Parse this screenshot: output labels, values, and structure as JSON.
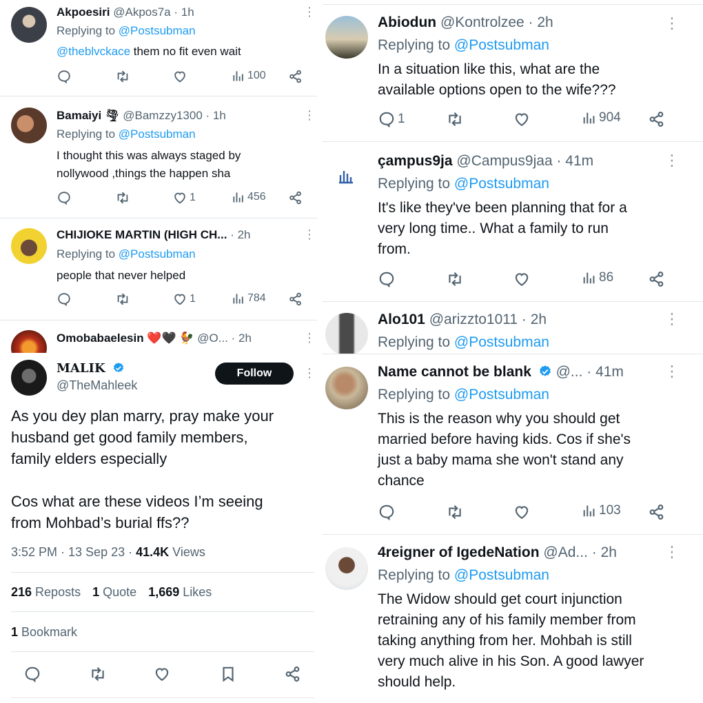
{
  "left_replies": [
    {
      "name": "Akpoesiri",
      "handle": "@Akpos7a",
      "time": "· 1h",
      "replying_label": "Replying to",
      "replying_handle": "@Postsubman",
      "mention": "@theblvckace",
      "text": " them no fit even wait",
      "reply_count": "",
      "like_count": "",
      "views": "100"
    },
    {
      "name": "Bamaiyi 🌪",
      "handle": "@Bamzzy1300",
      "time": "· 1h",
      "replying_label": "Replying to",
      "replying_handle": "@Postsubman",
      "text_lines": [
        "I thought this was always staged by",
        "nollywood ,things the  happen sha"
      ],
      "reply_count": "",
      "like_count": "1",
      "views": "456"
    },
    {
      "name": "CHIJIOKE MARTIN (HIGH CH...",
      "handle": "",
      "time": "· 2h",
      "replying_label": "Replying to",
      "replying_handle": "@Postsubman",
      "text_lines": [
        "people that never helped"
      ],
      "reply_count": "",
      "like_count": "1",
      "views": "784"
    },
    {
      "name": "Omobabaelesin ❤️🖤 🐓",
      "handle": "@O...",
      "time": "· 2h"
    }
  ],
  "main_tweet": {
    "name": "MALIK",
    "handle": "@TheMahleek",
    "follow_label": "Follow",
    "text_lines": [
      "As you dey plan marry, pray make your",
      "husband get good family members,",
      "family elders especially",
      "",
      "Cos what are these videos I’m seeing",
      "from Mohbad’s burial ffs??"
    ],
    "timestamp": "3:52 PM · 13 Sep 23 · ",
    "views": "41.4K",
    "views_label": " Views",
    "reposts": "216",
    "reposts_label": " Reposts",
    "quotes": "1",
    "quotes_label": " Quote",
    "likes": "1,669",
    "likes_label": " Likes",
    "bookmarks": "1",
    "bookmarks_label": " Bookmark"
  },
  "right_replies": [
    {
      "name": "Abiodun",
      "handle": "@Kontrolzee",
      "time": "· 2h",
      "replying_label": "Replying to",
      "replying_handle": "@Postsubman",
      "text_lines": [
        "In a situation like this, what are the",
        "available options open to the wife???"
      ],
      "reply_count": "1",
      "like_count": "",
      "views": "904"
    },
    {
      "name": "çampus9ja",
      "handle": "@Campus9jaa",
      "time": "· 41m",
      "replying_label": "Replying to",
      "replying_handle": "@Postsubman",
      "text_lines": [
        "It's like they've been planning that for a",
        "very long time.. What a family to run",
        "from."
      ],
      "reply_count": "",
      "like_count": "",
      "views": "86"
    },
    {
      "name": "Alo101",
      "handle": "@arizzto1011",
      "time": "· 2h",
      "replying_label": "Replying to",
      "replying_handle": "@Postsubman"
    },
    {
      "name": "Name cannot be blank",
      "handle": "@...",
      "time": "· 41m",
      "replying_label": "Replying to",
      "replying_handle": "@Postsubman",
      "text_lines": [
        "This is the reason why you should get",
        "married before having kids. Cos if she's",
        "just a baby mama she won't stand any",
        "chance"
      ],
      "reply_count": "",
      "like_count": "",
      "views": "103"
    },
    {
      "name": "4reigner of IgedeNation",
      "handle": "@Ad...",
      "time": "· 2h",
      "replying_label": "Replying to",
      "replying_handle": "@Postsubman",
      "text_lines": [
        "The Widow should get court injunction",
        "retraining any of his family member from",
        "taking anything from her. Mohbah is still",
        "very much alive in his Son. A good lawyer",
        "should help."
      ]
    }
  ],
  "colors": {
    "link": "#1d9bf0",
    "text": "#0f1419",
    "muted": "#536471",
    "divider": "#e1e6ea",
    "follow_bg": "#0f1419"
  }
}
